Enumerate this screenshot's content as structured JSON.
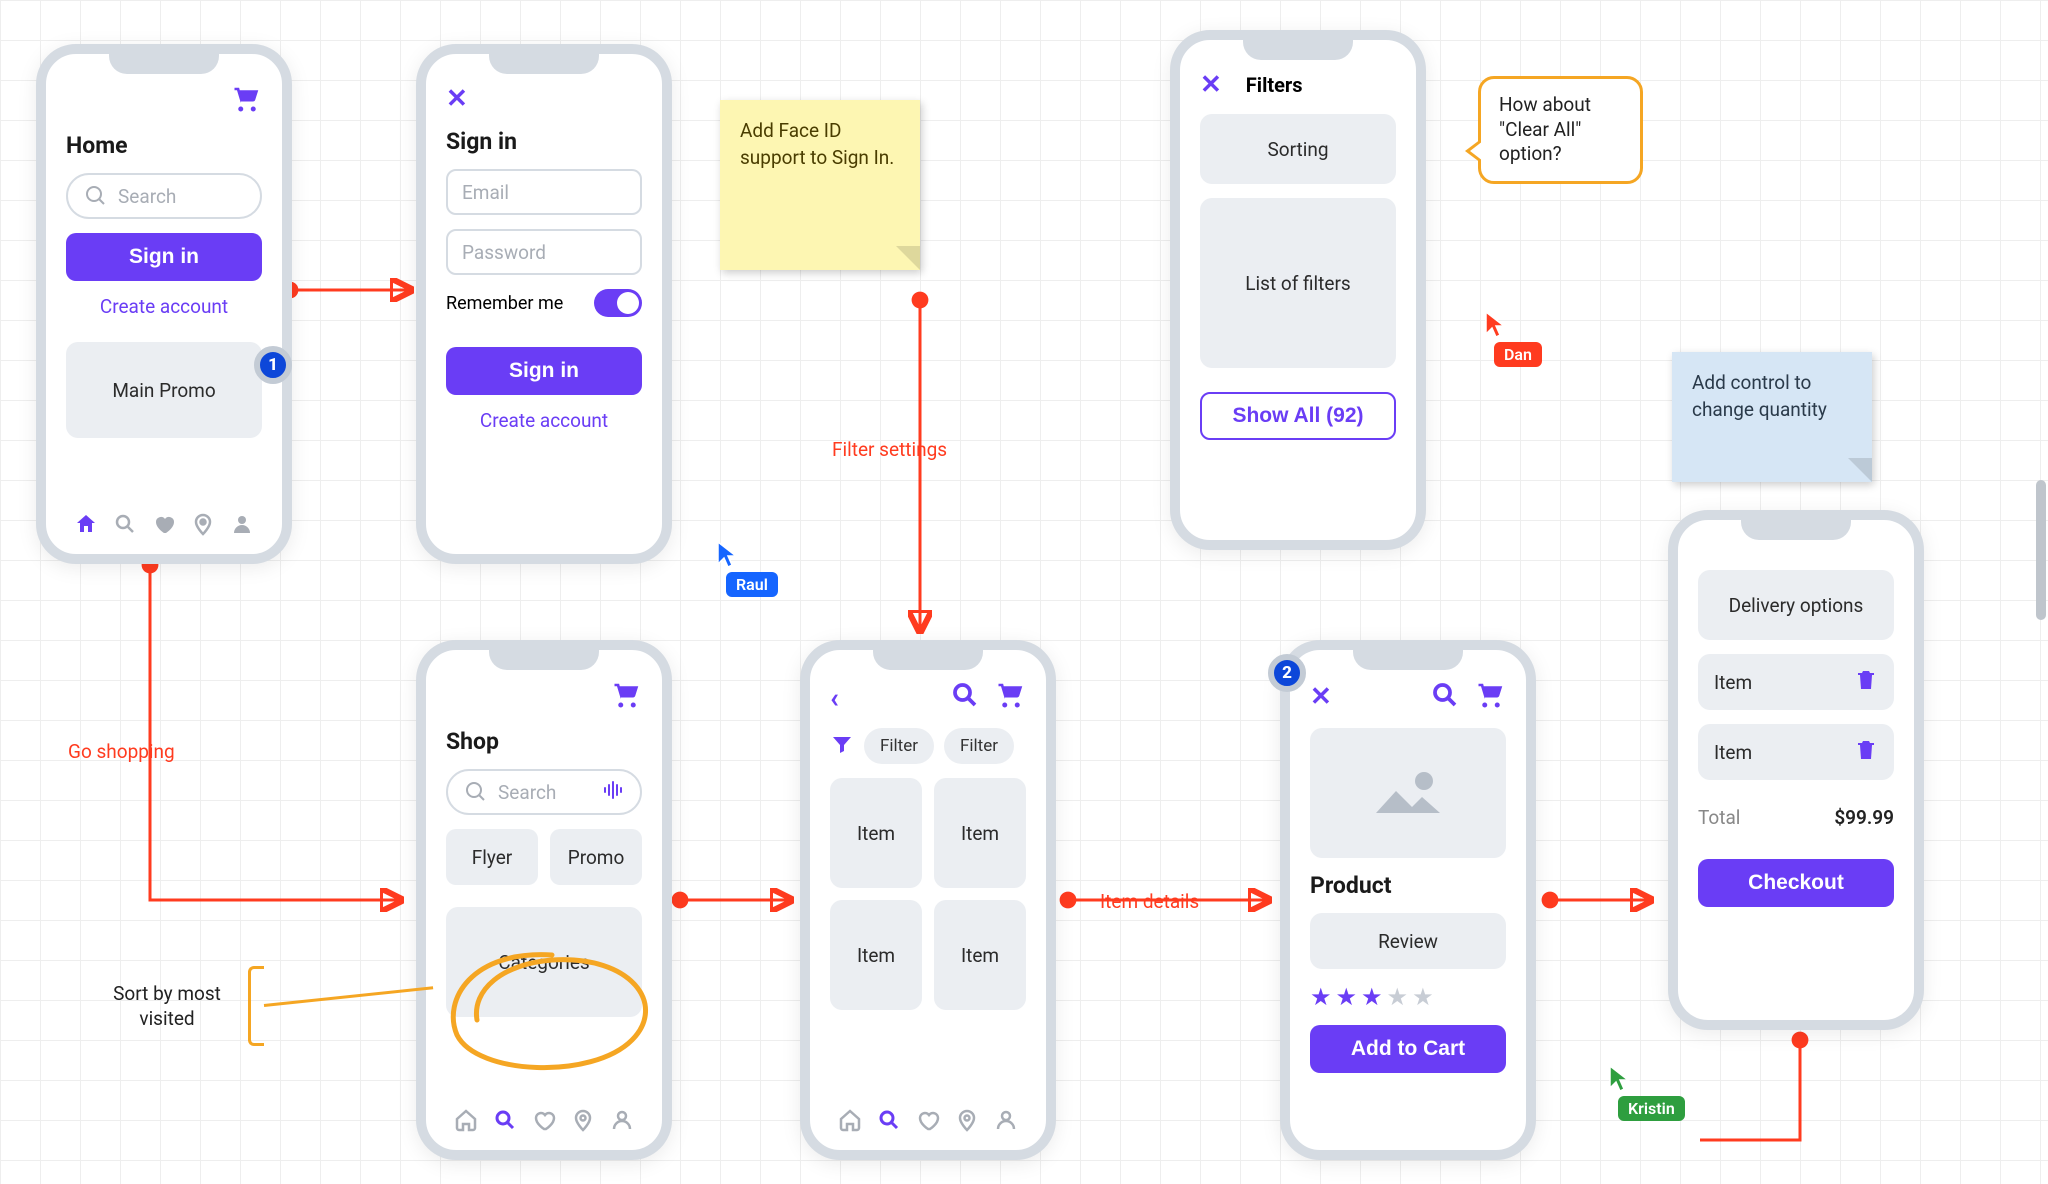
{
  "home": {
    "title": "Home",
    "search_placeholder": "Search",
    "signin_btn": "Sign in",
    "create_account": "Create account",
    "promo": "Main Promo"
  },
  "signin": {
    "title": "Sign in",
    "email_placeholder": "Email",
    "password_placeholder": "Password",
    "remember": "Remember me",
    "signin_btn": "Sign in",
    "create_account": "Create account"
  },
  "filters": {
    "title": "Filters",
    "sorting": "Sorting",
    "list": "List of filters",
    "show_all": "Show All (92)"
  },
  "shop": {
    "title": "Shop",
    "search_placeholder": "Search",
    "flyer": "Flyer",
    "promo": "Promo",
    "categories": "Categories"
  },
  "items": {
    "filter_chip_1": "Filter",
    "filter_chip_2": "Filter",
    "item_label": "Item"
  },
  "product": {
    "title": "Product",
    "review": "Review",
    "add_to_cart": "Add to Cart"
  },
  "cart": {
    "delivery": "Delivery options",
    "item_label": "Item",
    "total_label": "Total",
    "total_value": "$99.99",
    "checkout": "Checkout"
  },
  "sticky_yellow_text": "Add Face ID support to Sign In.",
  "sticky_blue_text": "Add control to change quantity",
  "bubble_text": "How about \"Clear All\" option?",
  "arrows": {
    "go_shopping": "Go shopping",
    "filter_settings": "Filter settings",
    "item_details": "Item details"
  },
  "annotations": {
    "sort_by_most_visited": "Sort by most visited"
  },
  "cursors": {
    "raul": "Raul",
    "dan": "Dan",
    "kristin": "Kristin"
  },
  "badges": {
    "b1": "1",
    "b2": "2"
  },
  "colors": {
    "primary": "#6a3df5",
    "red": "#ff3b1f",
    "orange": "#f5a623",
    "blue_cursor": "#1565ff",
    "green_cursor": "#2e9e3f"
  }
}
